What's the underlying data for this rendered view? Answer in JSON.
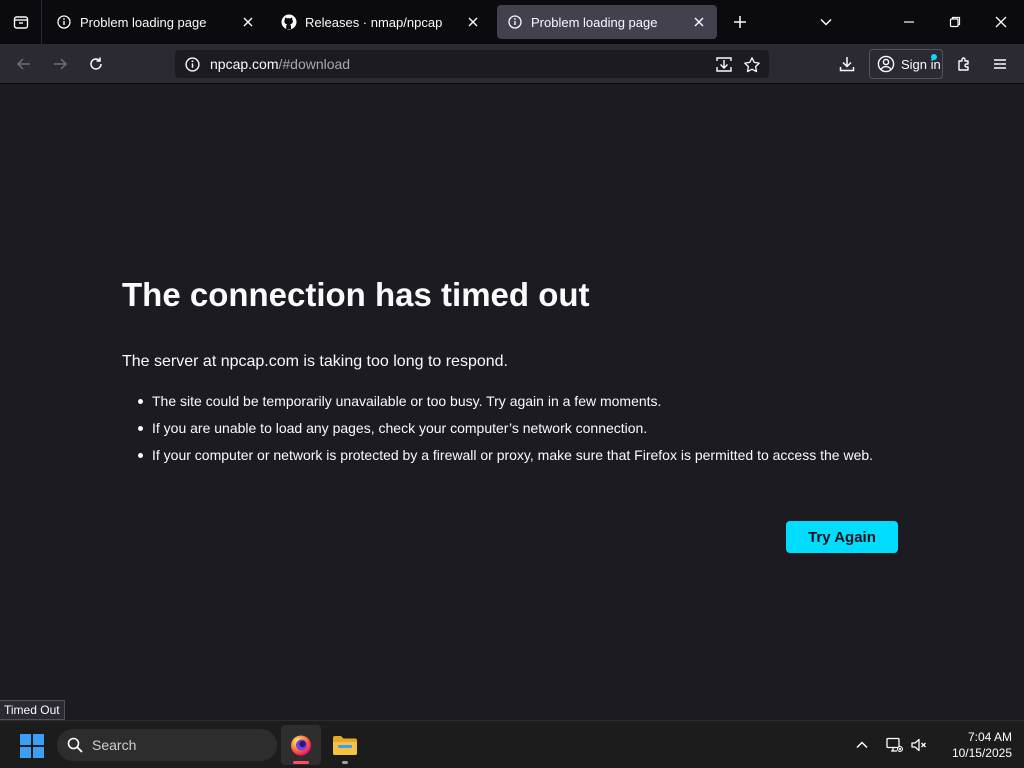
{
  "browser": {
    "tabs": [
      {
        "title": "Problem loading page",
        "icon": "info-icon",
        "active": false
      },
      {
        "title": "Releases · nmap/npcap",
        "icon": "github-icon",
        "active": false
      },
      {
        "title": "Problem loading page",
        "icon": "info-icon",
        "active": true
      }
    ],
    "url": {
      "host": "npcap.com",
      "path": "/#download"
    },
    "signin_label": "Sign in"
  },
  "error_page": {
    "title": "The connection has timed out",
    "description": "The server at npcap.com is taking too long to respond.",
    "bullets": [
      "The site could be temporarily unavailable or too busy. Try again in a few moments.",
      "If you are unable to load any pages, check your computer’s network connection.",
      "If your computer or network is protected by a firewall or proxy, make sure that Firefox is permitted to access the web."
    ],
    "try_again_label": "Try Again"
  },
  "status_tooltip": "Timed Out",
  "taskbar": {
    "search_label": "Search",
    "time": "7:04 AM",
    "date": "10/15/2025"
  },
  "colors": {
    "accent": "#00ddff",
    "page_bg": "#1c1b22",
    "toolbar_bg": "#2b2a33",
    "tabstrip_bg": "#0b0a0f",
    "firefox_indicator": "#ff4f5e",
    "explorer_folder": "#f6c244"
  }
}
